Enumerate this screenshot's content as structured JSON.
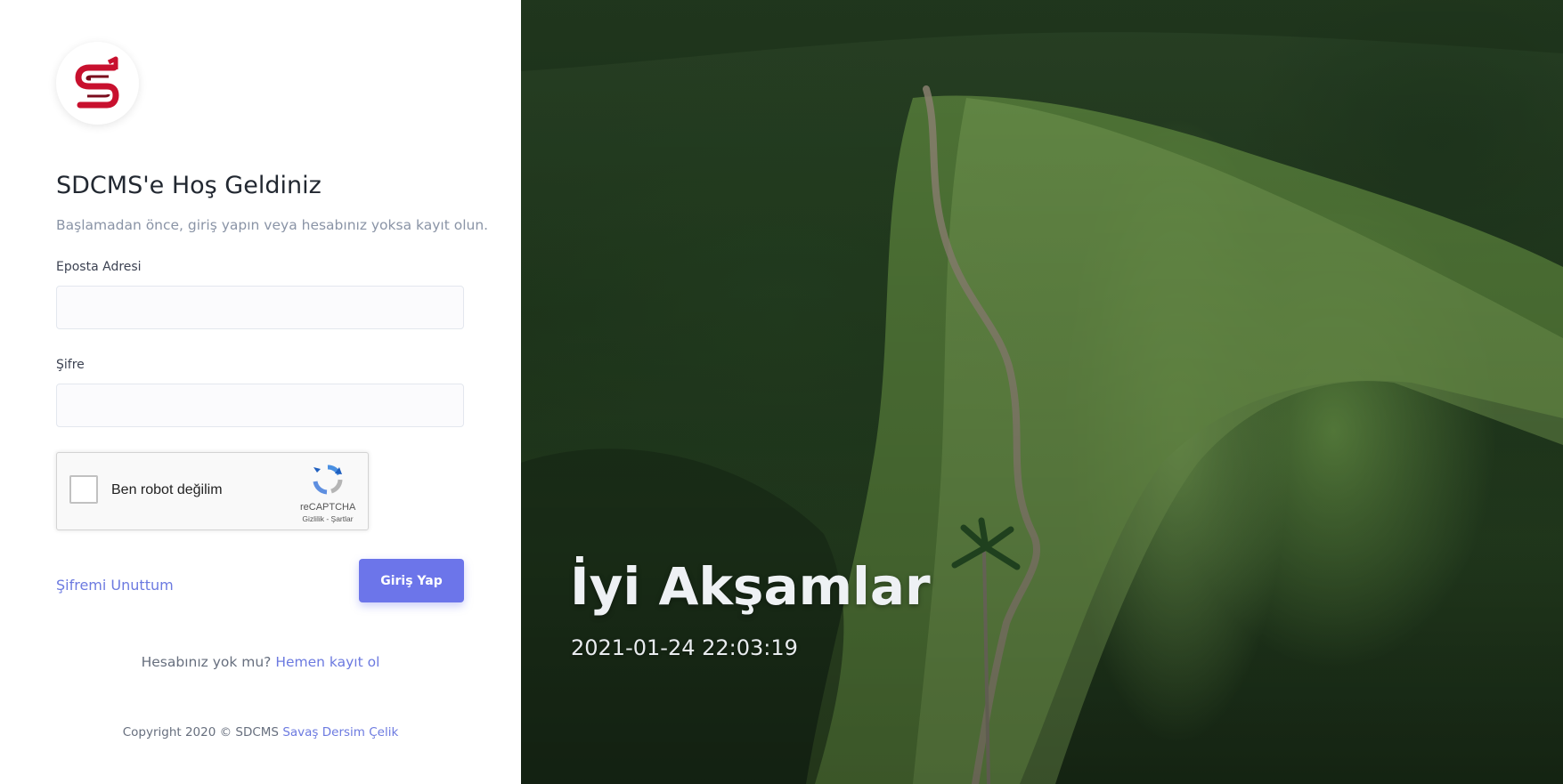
{
  "brand": {
    "logo_letter": "S",
    "accent_color": "#c8102e"
  },
  "login": {
    "title": "SDCMS'e Hoş Geldiniz",
    "subtitle": "Başlamadan önce, giriş yapın veya hesabınız yoksa kayıt olun.",
    "email_label": "Eposta Adresi",
    "email_value": "",
    "password_label": "Şifre",
    "password_value": "",
    "forgot_label": "Şifremi Unuttum",
    "submit_label": "Giriş Yap",
    "button_color": "#6c75ea"
  },
  "captcha": {
    "checkbox_label": "Ben robot değilim",
    "brand": "reCAPTCHA",
    "terms": "Gizlilik - Şartlar",
    "icon": "recaptcha-icon"
  },
  "signup": {
    "prompt": "Hesabınız yok mu?",
    "link_label": "Hemen kayıt ol"
  },
  "footer": {
    "copyright": "Copyright 2020 © SDCMS",
    "author": "Savaş Dersim Çelik"
  },
  "hero": {
    "greeting": "İyi Akşamlar",
    "datetime": "2021-01-24 22:03:19"
  }
}
